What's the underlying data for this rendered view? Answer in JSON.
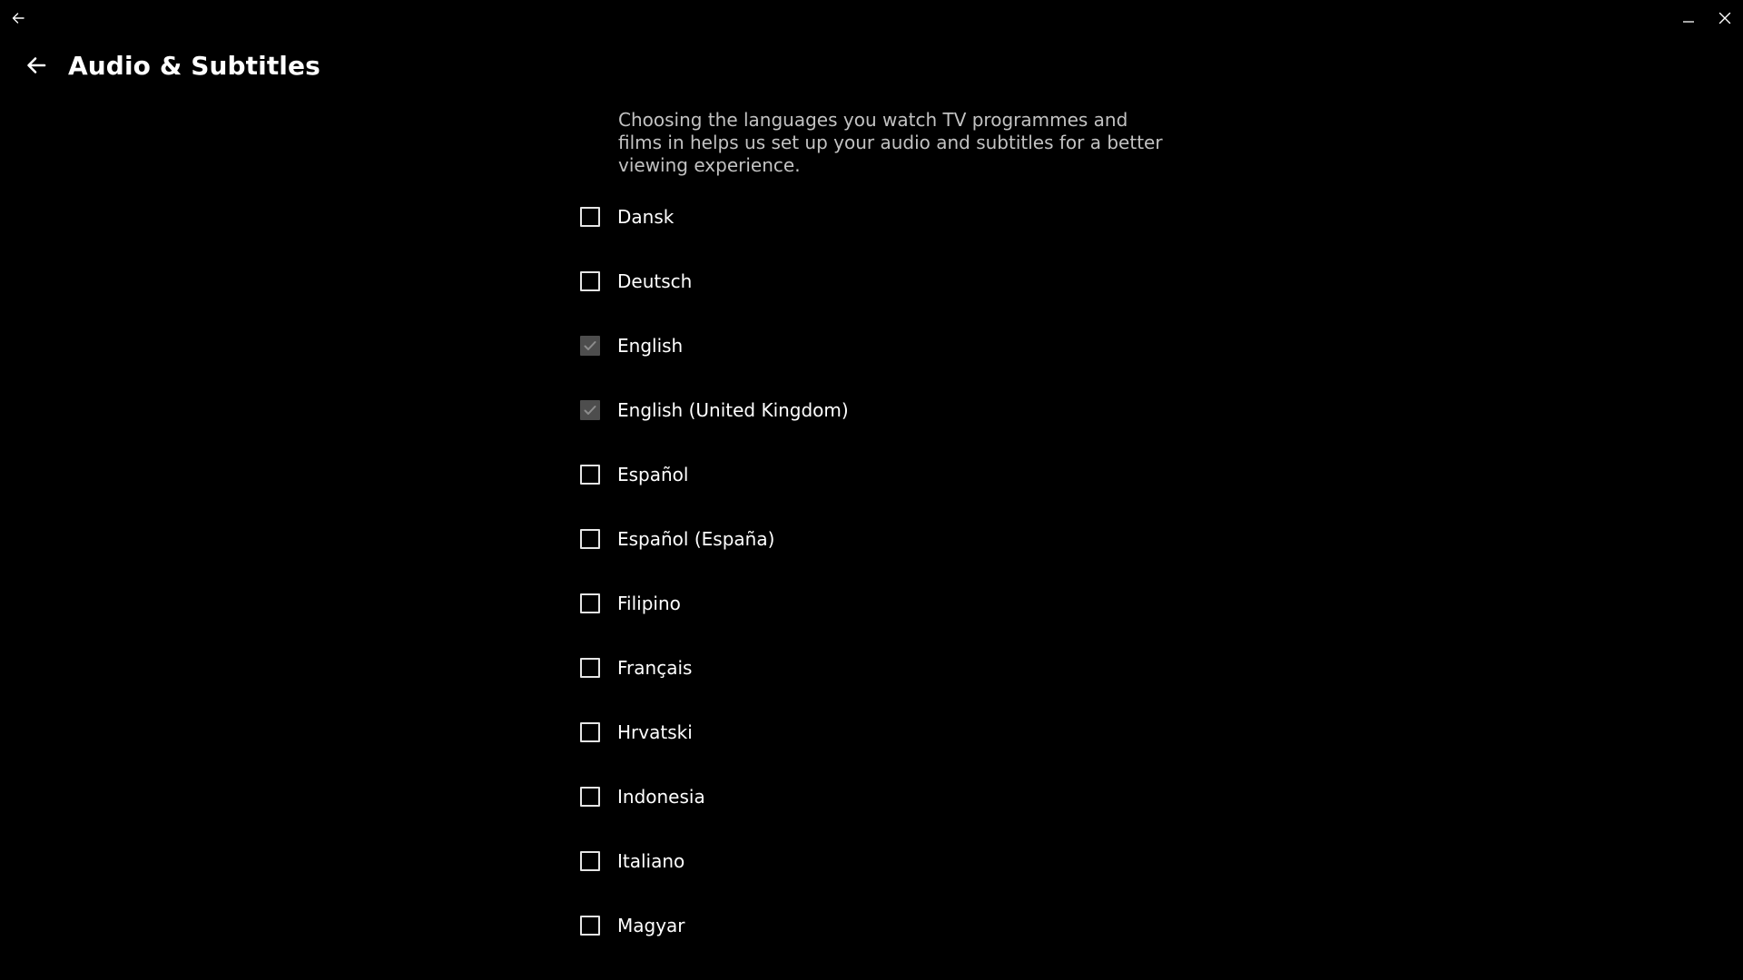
{
  "window": {
    "titlebar": {
      "back_icon": "arrow-left-icon",
      "minimize_icon": "minimize-icon",
      "close_icon": "close-icon"
    }
  },
  "header": {
    "back_icon": "arrow-left-icon",
    "title": "Audio & Subtitles"
  },
  "main": {
    "description": "Choosing the languages you watch TV programmes and films in helps us set up your audio and subtitles for a better viewing experience.",
    "languages": [
      {
        "label": "Dansk",
        "checked": false
      },
      {
        "label": "Deutsch",
        "checked": false
      },
      {
        "label": "English",
        "checked": true
      },
      {
        "label": "English (United Kingdom)",
        "checked": true
      },
      {
        "label": "Español",
        "checked": false
      },
      {
        "label": "Español (España)",
        "checked": false
      },
      {
        "label": "Filipino",
        "checked": false
      },
      {
        "label": "Français",
        "checked": false
      },
      {
        "label": "Hrvatski",
        "checked": false
      },
      {
        "label": "Indonesia",
        "checked": false
      },
      {
        "label": "Italiano",
        "checked": false
      },
      {
        "label": "Magyar",
        "checked": false
      },
      {
        "label": "",
        "checked": false
      }
    ]
  },
  "colors": {
    "background": "#000000",
    "text": "#ffffff",
    "description_text": "#c2c2c2",
    "checkbox_border": "#e5e5e5",
    "checkbox_checked": "#4d4d4d"
  }
}
